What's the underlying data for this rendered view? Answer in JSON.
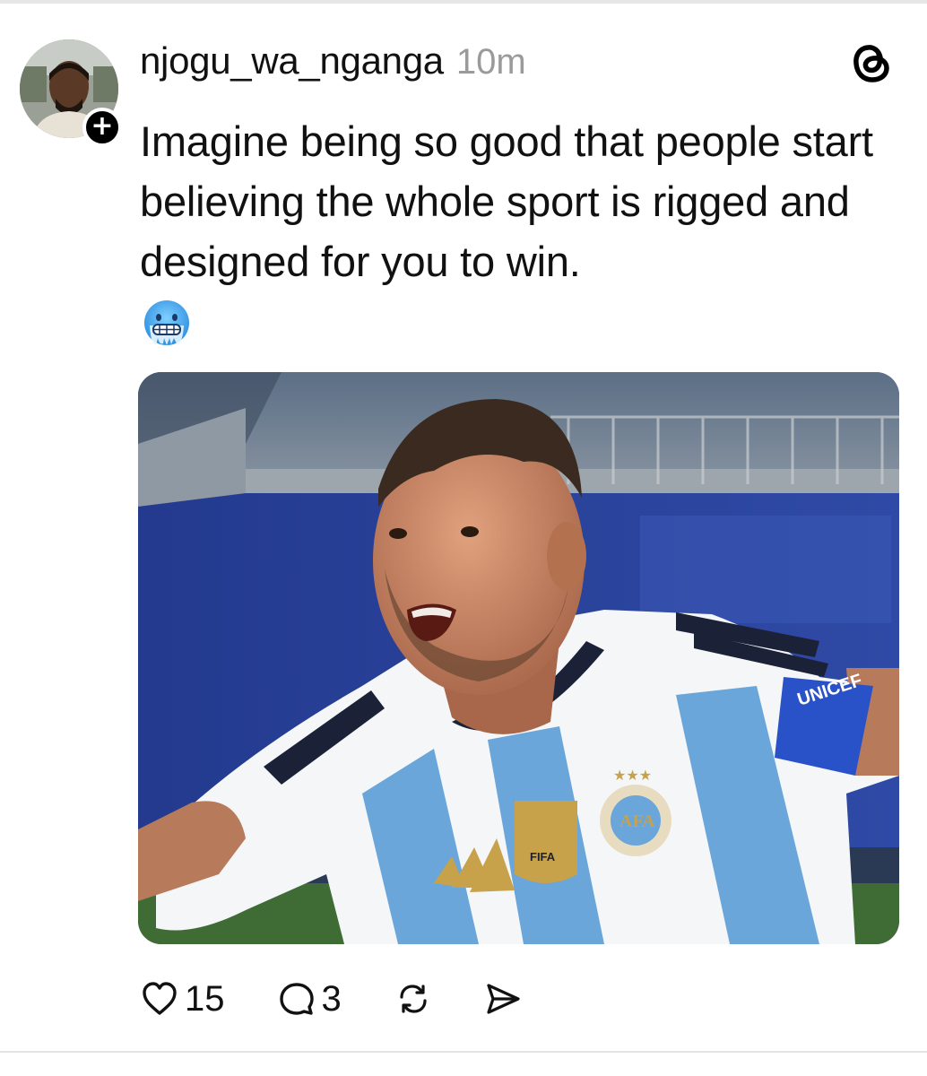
{
  "post": {
    "author": {
      "username": "njogu_wa_nganga",
      "avatar_icon": "profile-photo",
      "follow_badge": "+"
    },
    "timestamp": "10m",
    "app_icon": "threads-logo-icon",
    "text": "Imagine being so good that people start believing the whole sport is rigged and designed for you to win.",
    "emoji_icon": "cold-face-emoji",
    "image": {
      "subject": "football player in striped blue and white jersey celebrating",
      "jersey_patch_text": "FIFA",
      "crest_text": "AFA",
      "armband_text": "UNICEF"
    },
    "actions": {
      "like_count": "15",
      "reply_count": "3",
      "repost_icon": "repost-icon",
      "share_icon": "send-icon"
    }
  },
  "colors": {
    "text": "#111111",
    "muted": "#9a9a9a",
    "jersey_blue": "#6aa6da",
    "background_blue": "#2b3d94"
  }
}
